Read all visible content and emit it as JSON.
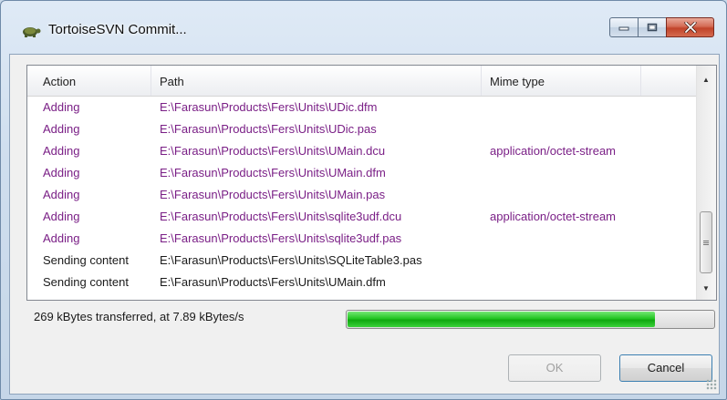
{
  "window": {
    "title": "TortoiseSVN Commit..."
  },
  "list": {
    "columns": {
      "action": "Action",
      "path": "Path",
      "mime": "Mime type"
    },
    "rows": [
      {
        "action": "Adding",
        "path": "E:\\Farasun\\Products\\Fers\\Units\\UDic.dfm",
        "mime": "",
        "kind": "added"
      },
      {
        "action": "Adding",
        "path": "E:\\Farasun\\Products\\Fers\\Units\\UDic.pas",
        "mime": "",
        "kind": "added"
      },
      {
        "action": "Adding",
        "path": "E:\\Farasun\\Products\\Fers\\Units\\UMain.dcu",
        "mime": "application/octet-stream",
        "kind": "added"
      },
      {
        "action": "Adding",
        "path": "E:\\Farasun\\Products\\Fers\\Units\\UMain.dfm",
        "mime": "",
        "kind": "added"
      },
      {
        "action": "Adding",
        "path": "E:\\Farasun\\Products\\Fers\\Units\\UMain.pas",
        "mime": "",
        "kind": "added"
      },
      {
        "action": "Adding",
        "path": "E:\\Farasun\\Products\\Fers\\Units\\sqlite3udf.dcu",
        "mime": "application/octet-stream",
        "kind": "added"
      },
      {
        "action": "Adding",
        "path": "E:\\Farasun\\Products\\Fers\\Units\\sqlite3udf.pas",
        "mime": "",
        "kind": "added"
      },
      {
        "action": "Sending content",
        "path": "E:\\Farasun\\Products\\Fers\\Units\\SQLiteTable3.pas",
        "mime": "",
        "kind": "normal"
      },
      {
        "action": "Sending content",
        "path": "E:\\Farasun\\Products\\Fers\\Units\\UMain.dfm",
        "mime": "",
        "kind": "normal"
      }
    ]
  },
  "status": {
    "text": "269 kBytes transferred, at 7.89 kBytes/s",
    "progress_fraction": 0.84
  },
  "buttons": {
    "ok": "OK",
    "cancel": "Cancel"
  },
  "colors": {
    "added": "#7a1f86",
    "progress": "#1fbf1f",
    "titlebar": "#cfdeee"
  },
  "icons": {
    "app": "tortoise-icon",
    "minimize": "minimize-icon",
    "maximize": "maximize-icon",
    "close": "close-icon"
  }
}
